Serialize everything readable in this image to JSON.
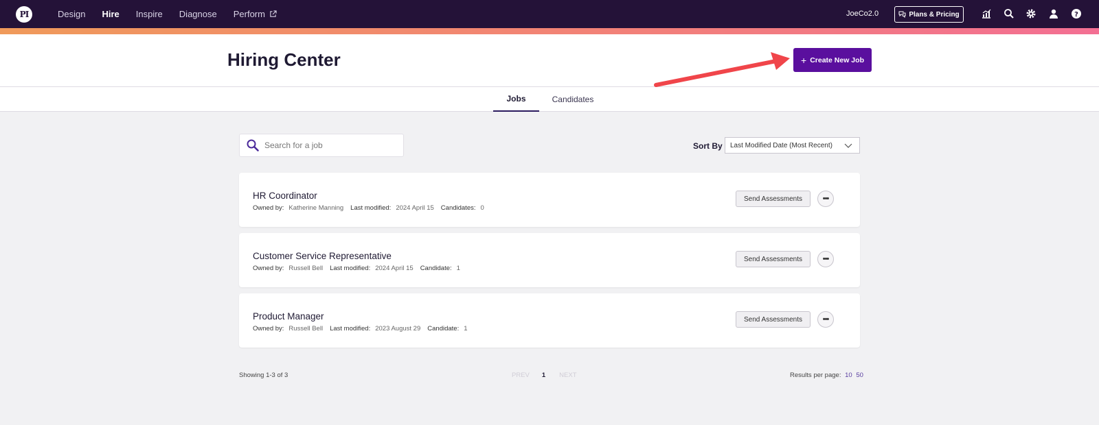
{
  "nav": {
    "logo_text": "PI",
    "links": [
      "Design",
      "Hire",
      "Inspire",
      "Diagnose",
      "Perform"
    ],
    "active": "Hire",
    "company": "JoeCo2.0",
    "plans_label": "Plans & Pricing",
    "icons": [
      "analytics-icon",
      "search-icon",
      "gear-icon",
      "user-icon",
      "help-icon"
    ]
  },
  "header": {
    "title": "Hiring Center",
    "create_label": "Create New Job",
    "create_icon": "plus-icon",
    "accent": "#5a0f9e",
    "annotation": "red-arrow pointing at Create New Job"
  },
  "tabs": [
    {
      "label": "Jobs",
      "active": true
    },
    {
      "label": "Candidates",
      "active": false
    }
  ],
  "toolbar": {
    "search_placeholder": "Search for a job",
    "sort_label": "Sort By",
    "sort_value": "Last Modified Date (Most Recent)"
  },
  "labels": {
    "owned_by": "Owned by:",
    "last_modified": "Last modified:",
    "send": "Send Assessments",
    "more": "•••"
  },
  "jobs": [
    {
      "title": "HR Coordinator",
      "owner": "Katherine Manning",
      "modified": "2024 April 15",
      "cand_label": "Candidates:",
      "count": "0"
    },
    {
      "title": "Customer Service Representative",
      "owner": "Russell Bell",
      "modified": "2024 April 15",
      "cand_label": "Candidate:",
      "count": "1"
    },
    {
      "title": "Product Manager",
      "owner": "Russell Bell",
      "modified": "2023 August 29",
      "cand_label": "Candidate:",
      "count": "1"
    }
  ],
  "footer": {
    "showing": "Showing 1-3 of 3",
    "prev": "PREV",
    "page": "1",
    "next": "NEXT",
    "per_page_label": "Results per page:",
    "per_page_options": [
      "10",
      "50"
    ]
  }
}
